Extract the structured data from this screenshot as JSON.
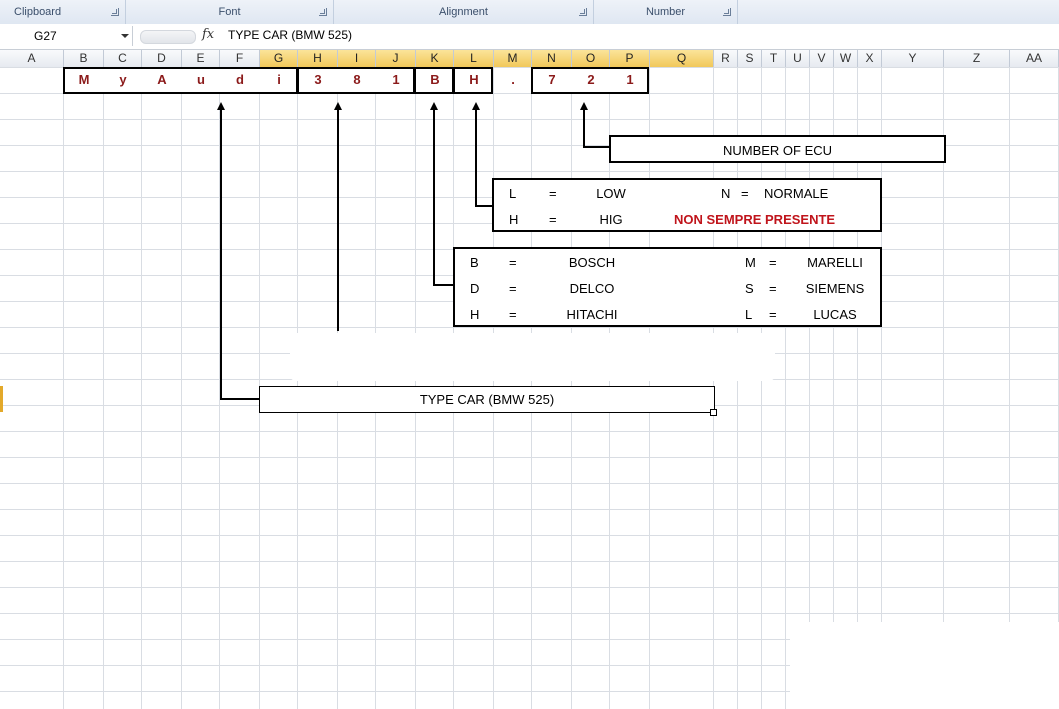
{
  "ribbon": {
    "groups": [
      "Clipboard",
      "Font",
      "Alignment",
      "Number"
    ]
  },
  "formula_bar": {
    "name_box": "G27",
    "fx": "fx",
    "content": "TYPE CAR (BMW 525)"
  },
  "columns": [
    "A",
    "B",
    "C",
    "D",
    "E",
    "F",
    "G",
    "H",
    "I",
    "J",
    "K",
    "L",
    "M",
    "N",
    "O",
    "P",
    "Q",
    "R",
    "S",
    "T",
    "U",
    "V",
    "W",
    "X",
    "Y",
    "Z",
    "AA"
  ],
  "code_chars": [
    "M",
    "y",
    "A",
    "u",
    "d",
    "i",
    "3",
    "8",
    "1",
    "B",
    "H",
    ".",
    "7",
    "2",
    "1"
  ],
  "ecu_label": "NUMBER OF ECU",
  "power_legend": {
    "rows": [
      {
        "code": "L",
        "eq": "=",
        "name": "LOW",
        "code2": "N",
        "eq2": "=",
        "name2": "NORMALE"
      },
      {
        "code": "H",
        "eq": "=",
        "name": "HIG",
        "note": "NON SEMPRE PRESENTE"
      }
    ]
  },
  "maker_legend": {
    "rows": [
      {
        "code": "B",
        "eq": "=",
        "name": "BOSCH",
        "code2": "M",
        "eq2": "=",
        "name2": "MARELLI"
      },
      {
        "code": "D",
        "eq": "=",
        "name": "DELCO",
        "code2": "S",
        "eq2": "=",
        "name2": "SIEMENS"
      },
      {
        "code": "H",
        "eq": "=",
        "name": "HITACHI",
        "code2": "L",
        "eq2": "=",
        "name2": "LUCAS"
      }
    ]
  },
  "type_car_label": "TYPE CAR (BMW 525)",
  "colors": {
    "code_text": "#8b1a1a",
    "note": "#c0141b",
    "selected_header": "#f1c85a"
  }
}
